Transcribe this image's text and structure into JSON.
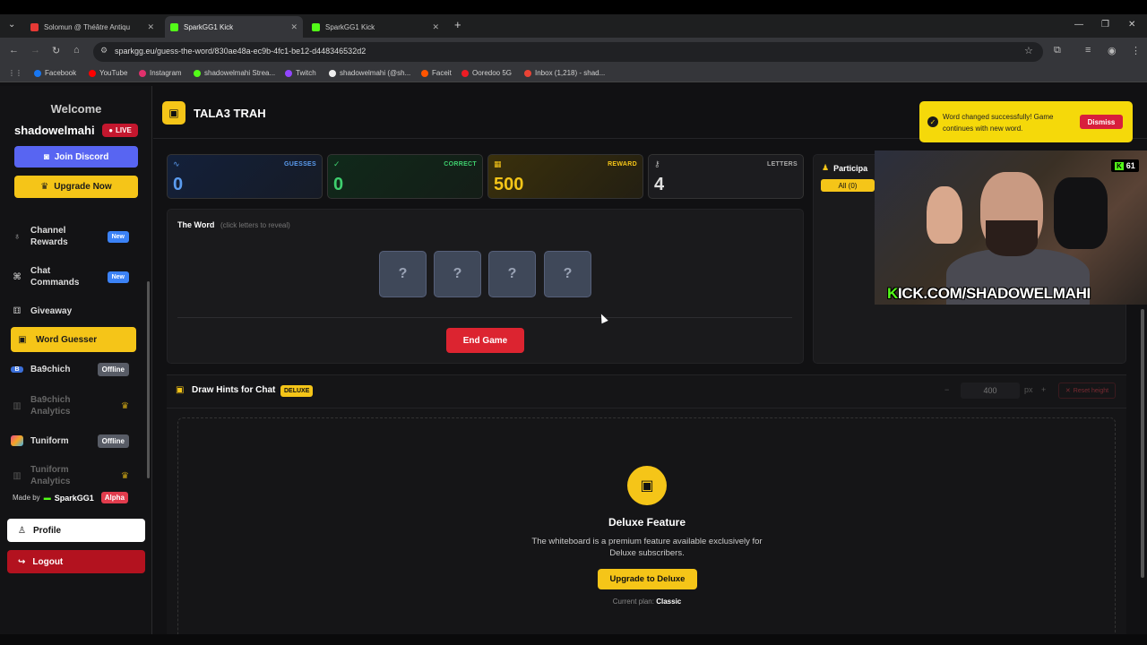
{
  "browser": {
    "tabs": [
      {
        "label": "Solomun @ Théâtre Antiqu"
      },
      {
        "label": "SparkGG1 Kick"
      },
      {
        "label": "SparkGG1 Kick"
      }
    ],
    "url": "sparkgg.eu/guess-the-word/830ae48a-ec9b-4fc1-be12-d448346532d2",
    "bookmarks": [
      {
        "label": "Facebook",
        "color": "#1877f2"
      },
      {
        "label": "YouTube",
        "color": "#ff0000"
      },
      {
        "label": "Instagram",
        "color": "#e1306c"
      },
      {
        "label": "shadowelmahi Strea...",
        "color": "#53fc18"
      },
      {
        "label": "Twitch",
        "color": "#9146ff"
      },
      {
        "label": "shadowelmahi (@sh...",
        "color": "#eeeeee"
      },
      {
        "label": "Faceit",
        "color": "#ff5500"
      },
      {
        "label": "Ooredoo 5G",
        "color": "#ed1c24"
      },
      {
        "label": "Inbox (1,218) - shad...",
        "color": "#ea4335"
      }
    ]
  },
  "sidebar": {
    "welcome": "Welcome",
    "username": "shadowelmahi",
    "live_badge": "LIVE",
    "discord_button": "Join Discord",
    "upgrade_button": "Upgrade Now",
    "items": [
      {
        "label": "Channel Rewards",
        "badge": "New"
      },
      {
        "label": "Chat Commands",
        "badge": "New"
      },
      {
        "label": "Giveaway"
      },
      {
        "label": "Word Guesser"
      },
      {
        "label": "Ba9chich",
        "badge": "Offline"
      },
      {
        "label": "Ba9chich Analytics"
      },
      {
        "label": "Tuniform",
        "badge": "Offline"
      },
      {
        "label": "Tuniform Analytics"
      }
    ],
    "made_by": "Made by",
    "made_by_brand": "SparkGG1",
    "alpha": "Alpha",
    "profile": "Profile",
    "logout": "Logout"
  },
  "header": {
    "title": "TALA3 TRAH"
  },
  "toast": {
    "message": "Word changed successfully! Game continues with new word.",
    "dismiss": "Dismiss"
  },
  "stats": [
    {
      "label": "GUESSES",
      "value": "0",
      "color": "#5b9cf0"
    },
    {
      "label": "CORRECT",
      "value": "0",
      "color": "#3ecf6e"
    },
    {
      "label": "REWARD",
      "value": "500",
      "color": "#f5c518"
    },
    {
      "label": "LETTERS",
      "value": "4",
      "color": "#cfcfcf"
    }
  ],
  "word": {
    "title": "The Word",
    "hint": "(click letters to reveal)",
    "tiles": [
      "?",
      "?",
      "?",
      "?"
    ],
    "end_button": "End Game"
  },
  "participants": {
    "title": "Participa",
    "filter": "All (0)"
  },
  "stream": {
    "url": "KICK.COM/SHADOWELMAHI",
    "viewers": "61"
  },
  "draw": {
    "title": "Draw Hints for Chat",
    "tag": "DELUXE",
    "height_value": "400",
    "unit": "px",
    "reset": "Reset height",
    "feature_title": "Deluxe Feature",
    "feature_desc": "The whiteboard is a premium feature available exclusively for Deluxe subscribers.",
    "upgrade_button": "Upgrade to Deluxe",
    "plan_label": "Current plan:",
    "plan_value": "Classic"
  }
}
